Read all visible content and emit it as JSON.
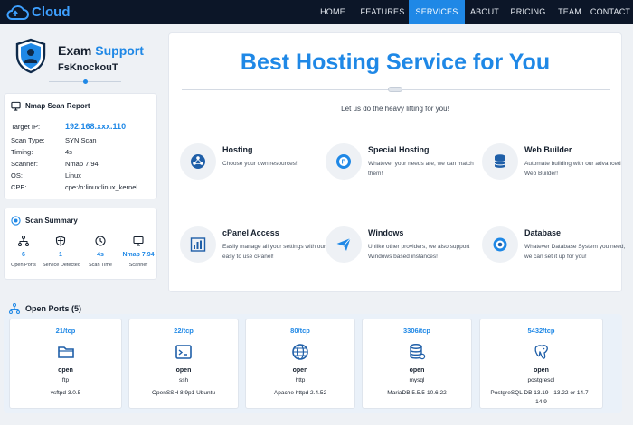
{
  "nav": {
    "logo": "Cloud",
    "items": [
      {
        "label": "HOME"
      },
      {
        "label": "FEATURES"
      },
      {
        "label": "SERVICES"
      },
      {
        "label": "ABOUT"
      },
      {
        "label": "PRICING"
      },
      {
        "label": "TEAM"
      },
      {
        "label": "CONTACT"
      }
    ],
    "active": "SERVICES"
  },
  "profile": {
    "title_main": "Exam ",
    "title_accent": "Support",
    "subtitle": "FsKnockouT"
  },
  "scan_report": {
    "title": "Nmap Scan Report",
    "rows": [
      {
        "key": "Target IP:",
        "value": "192.168.xxx.110"
      },
      {
        "key": "Scan Type:",
        "value": "SYN Scan"
      },
      {
        "key": "Timing:",
        "value": "4s"
      },
      {
        "key": "Scanner:",
        "value": "Nmap 7.94"
      },
      {
        "key": "OS:",
        "value": "Linux"
      },
      {
        "key": "CPE:",
        "value": "cpe:/o:linux:linux_kernel"
      }
    ]
  },
  "scan_summary": {
    "title": "Scan Summary",
    "items": [
      {
        "value": "6",
        "label": "Open Ports",
        "icon": "network-icon"
      },
      {
        "value": "1",
        "label": "Service Detected",
        "icon": "shield-icon"
      },
      {
        "value": "4s",
        "label": "Scan Time",
        "icon": "clock-icon"
      },
      {
        "value": "Nmap 7.94",
        "label": "Scanner",
        "icon": "monitor-icon"
      }
    ]
  },
  "main": {
    "title": "Best Hosting Service for You",
    "subtitle": "Let us do the heavy lifting for you!",
    "services": [
      {
        "title": "Hosting",
        "desc": "Choose your own resources!",
        "icon": "hosting-icon"
      },
      {
        "title": "Special Hosting",
        "desc": "Whatever your needs are, we can match them!",
        "icon": "special-hosting-icon"
      },
      {
        "title": "Web Builder",
        "desc": "Automate building with our advanced Web Builder!",
        "icon": "web-builder-icon"
      },
      {
        "title": "cPanel Access",
        "desc": "Easily manage all your settings with our easy to use cPanel!",
        "icon": "cpanel-icon"
      },
      {
        "title": "Windows",
        "desc": "Unlike other providers, we also support Windows based instances!",
        "icon": "windows-icon"
      },
      {
        "title": "Database",
        "desc": "Whatever Database System you need, we can set it up for you!",
        "icon": "database-icon"
      }
    ]
  },
  "open_ports": {
    "title": "Open Ports (5)",
    "ports": [
      {
        "port": "21/tcp",
        "state": "open",
        "service": "ftp",
        "version": "vsftpd 3.0.5",
        "icon": "folder-icon"
      },
      {
        "port": "22/tcp",
        "state": "open",
        "service": "ssh",
        "version": "OpenSSH 8.9p1 Ubuntu",
        "icon": "terminal-icon"
      },
      {
        "port": "80/tcp",
        "state": "open",
        "service": "http",
        "version": "Apache httpd 2.4.52",
        "icon": "globe-icon"
      },
      {
        "port": "3306/tcp",
        "state": "open",
        "service": "mysql",
        "version": "MariaDB 5.5.5-10.6.22",
        "icon": "database-icon"
      },
      {
        "port": "5432/tcp",
        "state": "open",
        "service": "postgresql",
        "version": "PostgreSQL DB 13.19 - 13.22 or 14.7 - 14.9",
        "icon": "postgres-icon"
      }
    ]
  },
  "colors": {
    "accent": "#1f88e6",
    "nav_bg": "#0c1628",
    "page_bg": "#eef1f5"
  }
}
